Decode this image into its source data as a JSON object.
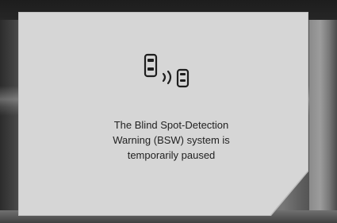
{
  "display": {
    "icon": "blind-spot-warning-icon",
    "message_lines": [
      "The Blind Spot-Detection",
      "Warning (BSW) system is",
      "temporarily paused"
    ]
  },
  "colors": {
    "screen_background": "#d6d6d6",
    "text": "#222222",
    "bezel": "#1d1d1d"
  }
}
